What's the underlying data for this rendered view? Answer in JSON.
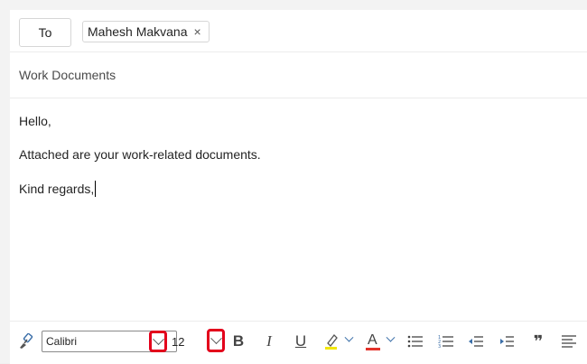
{
  "compose": {
    "to_label": "To",
    "recipients": [
      {
        "name": "Mahesh Makvana",
        "remove_glyph": "×"
      }
    ],
    "subject": "Work Documents",
    "body_lines": [
      "Hello,",
      "Attached are your work-related documents.",
      "Kind regards,"
    ]
  },
  "toolbar": {
    "font_name": "Calibri",
    "font_size": "12",
    "bold_label": "B",
    "italic_label": "I",
    "underline_label": "U",
    "font_color_label": "A",
    "quote_label": "❞",
    "icons": [
      "format-painter-icon",
      "font-dropdown-chevron-icon",
      "size-dropdown-chevron-icon",
      "bold-icon",
      "italic-icon",
      "underline-icon",
      "highlight-icon",
      "font-color-icon",
      "bullets-icon",
      "numbering-icon",
      "decrease-indent-icon",
      "increase-indent-icon",
      "quote-icon",
      "align-icon"
    ],
    "highlight_color": "#f2e600",
    "font_color": "#e3322b",
    "annotation_color": "#e3001b"
  }
}
